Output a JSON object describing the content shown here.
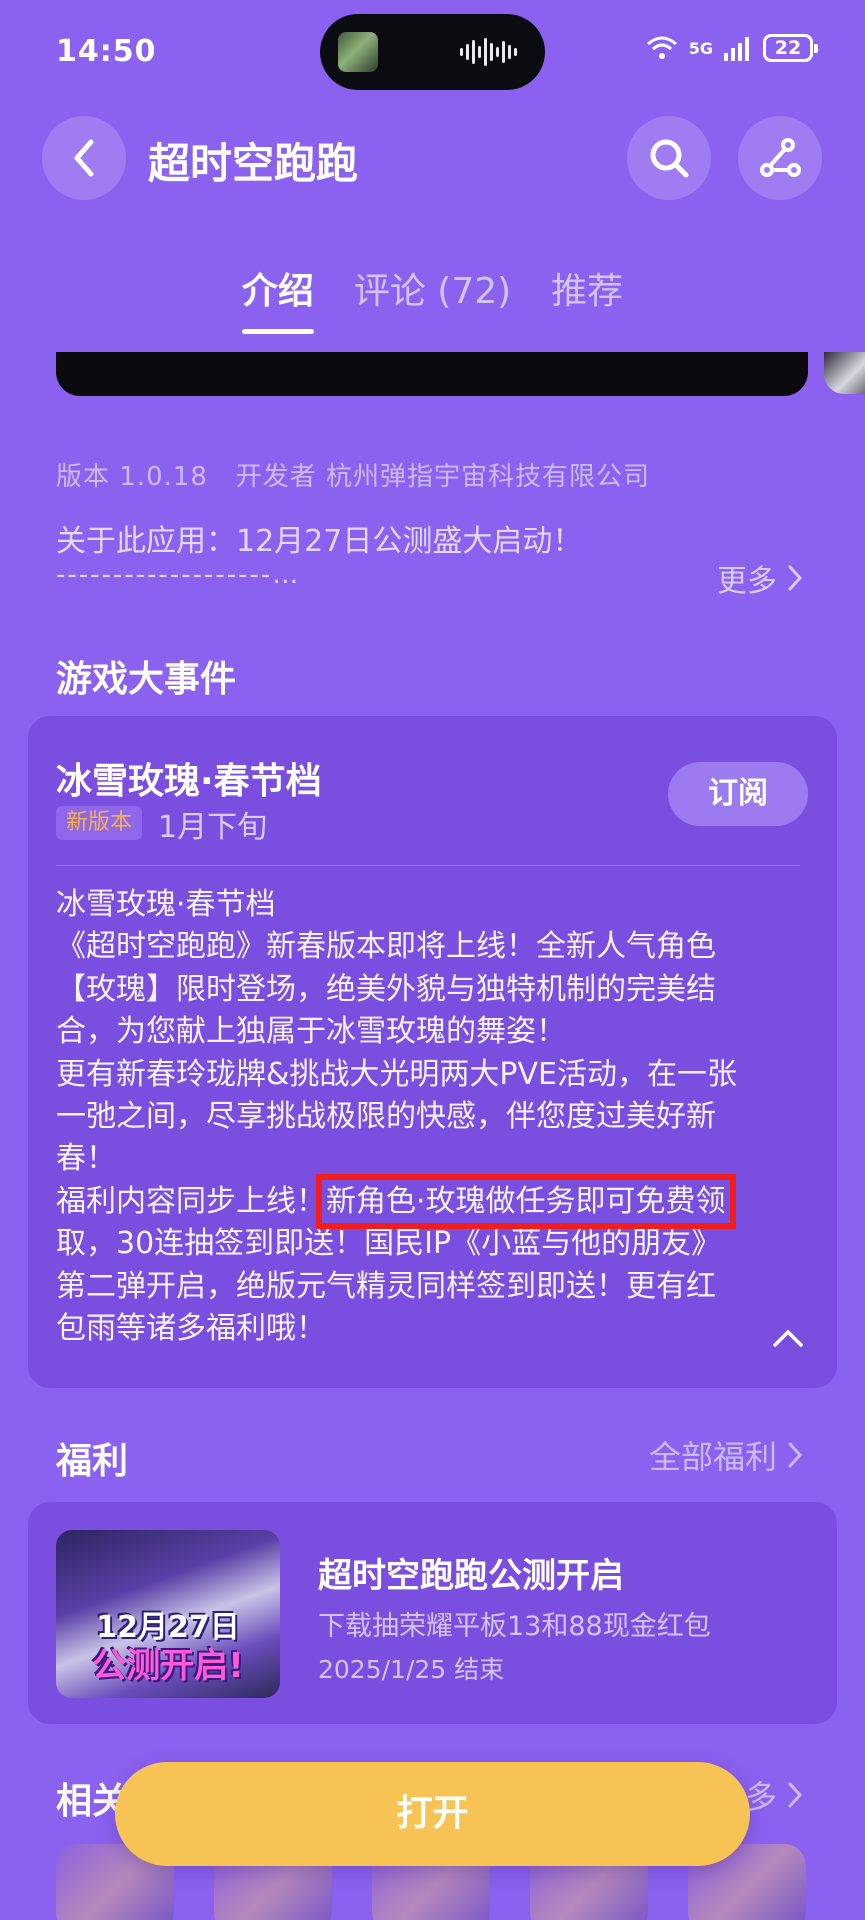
{
  "status": {
    "time": "14:50",
    "network": "5G",
    "battery": "22"
  },
  "header": {
    "title": "超时空跑跑",
    "back_icon": "chevron-left-icon",
    "search_icon": "search-icon",
    "share_icon": "share-icon"
  },
  "tabs": [
    {
      "label": "介绍"
    },
    {
      "label": "评论 (72)"
    },
    {
      "label": "推荐"
    }
  ],
  "info": {
    "meta": "版本 1.0.18   开发者 杭州弹指宇宙科技有限公司",
    "about": "关于此应用：12月27日公测盛大启动！",
    "about_dashes": "-------------------…",
    "more": "更多"
  },
  "events": {
    "section_title": "游戏大事件",
    "name": "冰雪玫瑰·春节档",
    "badge": "新版本",
    "date": "1月下旬",
    "subscribe": "订阅",
    "body": {
      "l1": "冰雪玫瑰·春节档",
      "l2": "《超时空跑跑》新春版本即将上线！全新人气角色",
      "l3": "【玫瑰】限时登场，绝美外貌与独特机制的完美结",
      "l4": "合，为您献上独属于冰雪玫瑰的舞姿！",
      "l5": "更有新春玲珑牌&挑战大光明两大PVE活动，在一张",
      "l6": "一弛之间，尽享挑战极限的快感，伴您度过美好新",
      "l7": "春！",
      "l8a": "福利内容同步上线！",
      "l8b": "新角色·玫瑰做任务即可免费领",
      "l9": "取，30连抽签到即送！国民IP《小蓝与他的朋友》",
      "l10": "第二弹开启，绝版元气精灵同样签到即送！更有红",
      "l11": "包雨等诸多福利哦！"
    }
  },
  "welfare": {
    "section_title": "福利",
    "all_label": "全部福利",
    "promo": {
      "image_date": "12月27日",
      "image_title": "公测开启!",
      "title": "超时空跑跑公测开启",
      "desc": "下载抽荣耀平板13和88现金红包",
      "end": "2025/1/25 结束"
    }
  },
  "related": {
    "section_title": "相关",
    "more": "多"
  },
  "open_button": "打开",
  "colors": {
    "background": "#8b62ef",
    "card": "#7a4fdf",
    "accent_button": "#f7c355",
    "highlight_box": "#f21d1d",
    "badge_text": "#f6b34b"
  }
}
